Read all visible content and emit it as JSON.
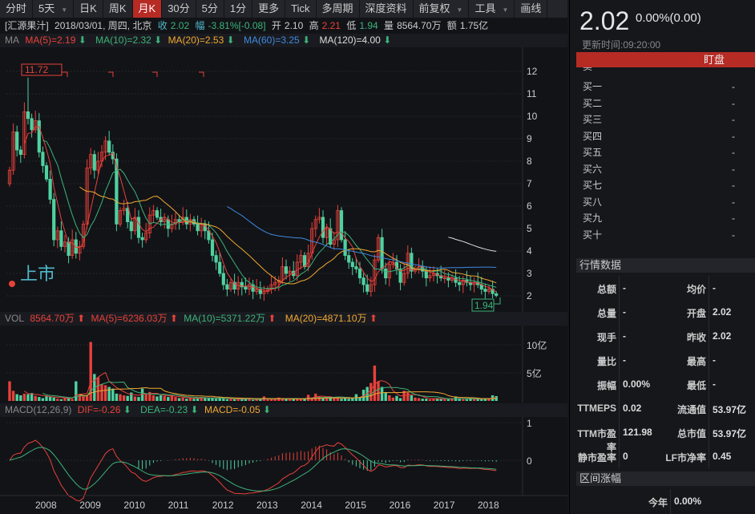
{
  "toolbar": {
    "tabs": [
      {
        "label": "分时"
      },
      {
        "label": "5天",
        "dropdown": true
      },
      {
        "label": "日K"
      },
      {
        "label": "周K"
      },
      {
        "label": "月K",
        "active": true
      },
      {
        "label": "30分"
      },
      {
        "label": "5分"
      },
      {
        "label": "1分"
      },
      {
        "label": "更多"
      },
      {
        "label": "Tick"
      },
      {
        "label": "多周期"
      },
      {
        "label": "深度资料"
      },
      {
        "label": "前复权",
        "dropdown": true
      },
      {
        "label": "工具",
        "dropdown": true
      },
      {
        "label": "画线"
      }
    ]
  },
  "info": {
    "name": "[汇源果汁]",
    "date": "2018/03/01, 周四, 北京",
    "close_label": "收",
    "close": "2.02",
    "amp_label": "幅",
    "amp": "-3.81%[-0.08]",
    "open_label": "开",
    "open": "2.10",
    "high_label": "高",
    "high": "2.21",
    "low_label": "低",
    "low": "1.94",
    "vol_label": "量",
    "vol": "8564.70万",
    "amt_label": "额",
    "amt": "1.75亿"
  },
  "ma": {
    "label": "MA",
    "ma5": "MA(5)=2.19",
    "ma10": "MA(10)=2.32",
    "ma20": "MA(20)=2.53",
    "ma60": "MA(60)=3.25",
    "ma120": "MA(120)=4.00"
  },
  "vol": {
    "label": "VOL",
    "value": "8564.70万",
    "ma5": "MA(5)=6236.03万",
    "ma10": "MA(10)=5371.22万",
    "ma20": "MA(20)=4871.10万"
  },
  "macd": {
    "label": "MACD(12,26,9)",
    "dif": "DIF=-0.26",
    "dea": "DEA=-0.23",
    "macd": "MACD=-0.05"
  },
  "annotations": {
    "high_label": "11.72",
    "low_label": "1.94",
    "listing": "上市"
  },
  "colors": {
    "up": "#e8413a",
    "down": "#4fd1a0",
    "ma5": "#e8413a",
    "ma10": "#3cb37a",
    "ma20": "#f0a830",
    "ma60": "#3d8ae0",
    "ma120": "#dddddd",
    "accent": "#b72b25"
  },
  "chart_data": {
    "type": "candlestick",
    "period": "monthly",
    "start": "2007/03",
    "end": "2018/03",
    "price_ticks": [
      2,
      3,
      4,
      5,
      6,
      7,
      8,
      9,
      10,
      11,
      12
    ],
    "volume_ticks": [
      "5亿",
      "10亿"
    ],
    "macd_ticks": [
      "0",
      "1"
    ],
    "x_ticks": [
      "2008",
      "2009",
      "2010",
      "2011",
      "2012",
      "2013",
      "2014",
      "2015",
      "2016",
      "2017",
      "2018"
    ],
    "closes": [
      7.6,
      9.3,
      8.5,
      8.3,
      10.2,
      9.9,
      9.4,
      9.8,
      8.4,
      7.8,
      7.2,
      6.3,
      4.5,
      4.9,
      4.2,
      4.4,
      3.8,
      4.5,
      3.9,
      4.2,
      5.2,
      7.7,
      8.3,
      7.6,
      8.0,
      8.4,
      8.9,
      8.4,
      8.1,
      5.2,
      5.8,
      5.9,
      5.3,
      4.9,
      5.5,
      4.6,
      4.5,
      4.8,
      5.6,
      5.8,
      5.5,
      5.3,
      5.4,
      5.0,
      5.2,
      5.4,
      5.3,
      5.5,
      5.2,
      5.4,
      5.2,
      4.9,
      5.2,
      4.9,
      4.5,
      3.8,
      3.5,
      3.0,
      2.5,
      2.3,
      2.6,
      2.3,
      2.6,
      2.4,
      2.3,
      2.5,
      2.2,
      2.3,
      2.1,
      2.2,
      2.3,
      2.5,
      2.6,
      2.7,
      3.3,
      3.0,
      3.1,
      2.9,
      3.5,
      3.8,
      3.3,
      3.9,
      5.0,
      5.4,
      5.5,
      4.6,
      5.0,
      4.3,
      4.5,
      5.8,
      4.5,
      3.8,
      3.5,
      3.3,
      3.2,
      2.8,
      2.5,
      2.2,
      2.5,
      3.6,
      4.6,
      3.2,
      2.8,
      3.4,
      3.5,
      3.2,
      2.6,
      3.0,
      3.9,
      3.1,
      3.2,
      3.3,
      3.1,
      2.8,
      2.9,
      3.0,
      2.9,
      2.8,
      2.8,
      2.7,
      2.8,
      2.6,
      2.5,
      2.7,
      2.6,
      2.5,
      2.6,
      2.5,
      2.3,
      2.2,
      2.3,
      2.1,
      2.02
    ],
    "volumes_yi": [
      3.5,
      1.8,
      1.2,
      1.0,
      1.3,
      1.2,
      1.4,
      0.9,
      0.7,
      0.5,
      0.9,
      0.8,
      0.6,
      0.4,
      0.3,
      0.5,
      0.6,
      0.3,
      3.5,
      1.1,
      0.8,
      0.9,
      10.5,
      4.8,
      4.2,
      3.0,
      2.8,
      2.5,
      2.2,
      1.3,
      1.2,
      1.0,
      0.9,
      1.5,
      0.8,
      0.7,
      2.2,
      1.2,
      1.6,
      1.0,
      0.8,
      1.0,
      0.9,
      0.7,
      1.0,
      0.7,
      0.5,
      0.6,
      0.4,
      0.5,
      0.4,
      0.5,
      0.7,
      0.6,
      0.5,
      0.5,
      0.4,
      0.6,
      0.4,
      0.3,
      0.3,
      0.3,
      0.5,
      0.3,
      0.4,
      0.3,
      0.2,
      0.3,
      0.3,
      0.8,
      0.3,
      0.3,
      0.4,
      0.6,
      0.4,
      0.3,
      0.3,
      0.5,
      0.4,
      0.3,
      0.4,
      1.1,
      0.5,
      1.3,
      0.8,
      0.6,
      0.5,
      0.5,
      0.6,
      0.7,
      0.4,
      0.5,
      0.4,
      0.5,
      1.2,
      0.6,
      2.0,
      2.5,
      3.2,
      6.3,
      3.5,
      2.5,
      1.5,
      1.0,
      0.6,
      0.9,
      0.5,
      1.8,
      1.5,
      1.0,
      0.6,
      0.5,
      0.4,
      0.4,
      0.3,
      0.4,
      0.5,
      0.4,
      0.3,
      0.3,
      0.4,
      0.8,
      0.4,
      0.3,
      0.3,
      0.4,
      0.3,
      0.4,
      0.3,
      0.5,
      0.4,
      1.0,
      0.86
    ]
  },
  "quote": {
    "price": "2.02",
    "change": "0.00%(0.00)",
    "update_time": "更新时间:09:20:00",
    "watch_button": "盯盘"
  },
  "orderbook": {
    "sell1": {
      "label": "卖一",
      "value": "-"
    },
    "buys": [
      {
        "label": "买一",
        "value": "-"
      },
      {
        "label": "买二",
        "value": "-"
      },
      {
        "label": "买三",
        "value": "-"
      },
      {
        "label": "买四",
        "value": "-"
      },
      {
        "label": "买五",
        "value": "-"
      },
      {
        "label": "买六",
        "value": "-"
      },
      {
        "label": "买七",
        "value": "-"
      },
      {
        "label": "买八",
        "value": "-"
      },
      {
        "label": "买九",
        "value": "-"
      },
      {
        "label": "买十",
        "value": "-"
      }
    ]
  },
  "market": {
    "title": "行情数据",
    "rows": [
      {
        "l1": "总额",
        "v1": "-",
        "l2": "均价",
        "v2": "-"
      },
      {
        "l1": "总量",
        "v1": "-",
        "l2": "开盘",
        "v2": "2.02"
      },
      {
        "l1": "现手",
        "v1": "-",
        "l2": "昨收",
        "v2": "2.02"
      },
      {
        "l1": "量比",
        "v1": "-",
        "l2": "最高",
        "v2": "-"
      },
      {
        "l1": "振幅",
        "v1": "0.00%",
        "l2": "最低",
        "v2": "-"
      },
      {
        "l1": "TTMEPS",
        "v1": "0.02",
        "l2": "流通值",
        "v2": "53.97亿"
      },
      {
        "l1": "TTM市盈率",
        "v1": "121.98",
        "l2": "总市值",
        "v2": "53.97亿"
      },
      {
        "l1": "静市盈率",
        "v1": "0",
        "l2": "LF市净率",
        "v2": "0.45"
      }
    ]
  },
  "range": {
    "title": "区间涨幅",
    "label": "今年",
    "value": "0.00%"
  }
}
